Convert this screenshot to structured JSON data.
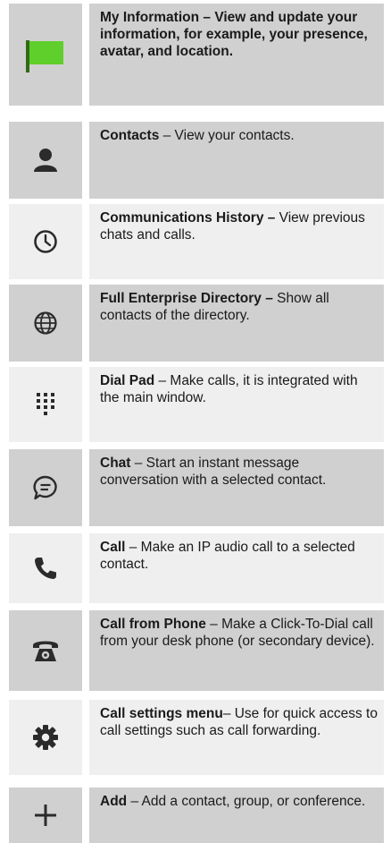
{
  "items": [
    {
      "icon": "green-flag-icon",
      "title": "My Information – View and update your information, for example, your presence, avatar, and location.",
      "desc": ""
    },
    {
      "icon": "person-icon",
      "title": "Contacts",
      "desc": " – View your contacts."
    },
    {
      "icon": "clock-icon",
      "title": "Communications History –",
      "desc": " View previous chats and calls."
    },
    {
      "icon": "globe-icon",
      "title": "Full Enterprise Directory –",
      "desc": " Show all contacts of the directory."
    },
    {
      "icon": "dial-pad-icon",
      "title": "Dial Pad",
      "desc": " – Make calls, it is integrated with the main window."
    },
    {
      "icon": "chat-bubble-icon",
      "title": "Chat",
      "desc": " – Start an instant message conversation with a selected contact."
    },
    {
      "icon": "phone-handset-icon",
      "title": "Call",
      "desc": " – Make an IP audio call to a selected contact."
    },
    {
      "icon": "desk-phone-icon",
      "title": "Call from Phone",
      "desc": " – Make a Click-To-Dial call from your desk phone (or secondary device)."
    },
    {
      "icon": "gear-icon",
      "title": "Call settings menu",
      "desc": "– Use for quick access to call settings such as call forwarding."
    },
    {
      "icon": "plus-icon",
      "title": "Add",
      "desc": " – Add a contact, group, or conference."
    }
  ],
  "colors": {
    "flag": "#5fcf2b",
    "icon": "#2b2b2b"
  }
}
